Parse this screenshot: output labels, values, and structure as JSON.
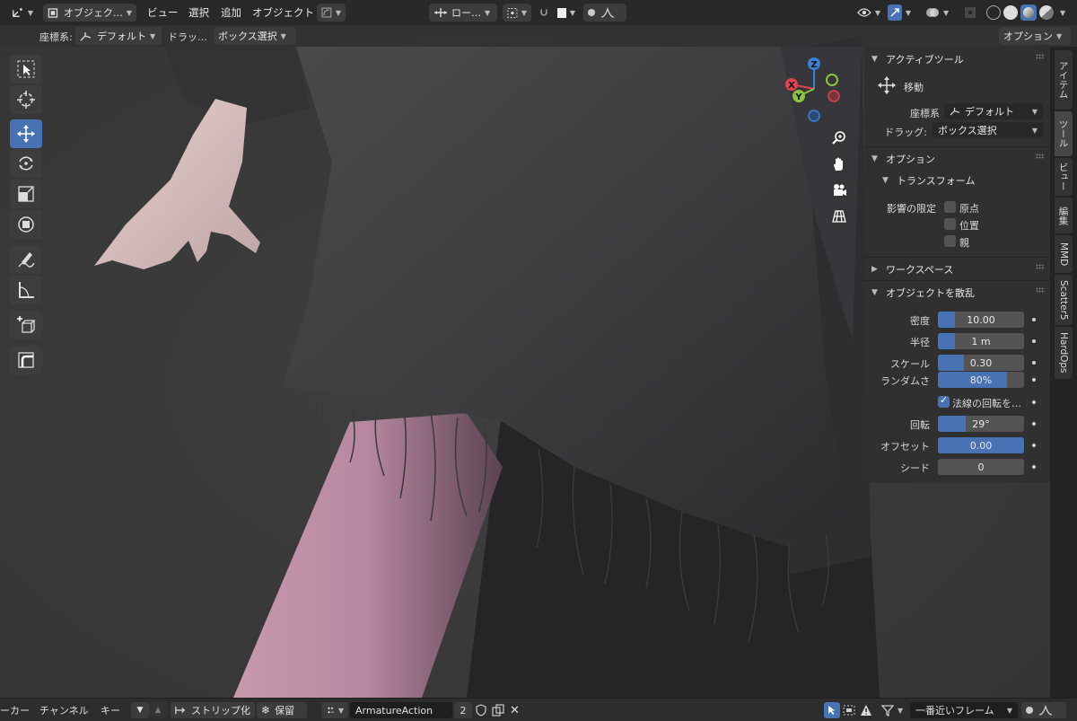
{
  "header": {
    "mode_label": "オブジェク…",
    "menus": [
      "ビュー",
      "選択",
      "追加",
      "オブジェクト"
    ],
    "pivot_label": "ロー…",
    "options_label": "オプション"
  },
  "tool_header": {
    "coord_label": "座標系:",
    "coord_value": "デフォルト",
    "drag_label": "ドラッ…",
    "drag_value": "ボックス選択"
  },
  "left_toolbar": {
    "tools": [
      "select-box",
      "cursor",
      "move",
      "rotate",
      "scale",
      "transform",
      "annotate",
      "measure",
      "add-cube",
      "extrude-shape"
    ],
    "active": "move"
  },
  "gizmo": {
    "x": "X",
    "y": "Y",
    "z": "Z"
  },
  "npanel": {
    "active_tool": {
      "header": "アクティブツール",
      "tool_name": "移動",
      "coord_label": "座標系",
      "coord_value": "デフォルト",
      "drag_label": "ドラッグ:",
      "drag_value": "ボックス選択"
    },
    "options": {
      "header": "オプション",
      "transform_header": "トランスフォーム",
      "affect_label": "影響の限定",
      "checks": [
        {
          "label": "原点",
          "checked": false
        },
        {
          "label": "位置",
          "checked": false
        },
        {
          "label": "親",
          "checked": false
        }
      ]
    },
    "workspace": {
      "header": "ワークスペース"
    },
    "scatter": {
      "header": "オブジェクトを散乱",
      "fields": [
        {
          "label": "密度",
          "value": "10.00",
          "fill": 0.2
        },
        {
          "label": "半径",
          "value": "1 m",
          "fill": 0.2
        },
        {
          "label": "スケール",
          "value": "0.30",
          "fill": 0.3
        },
        {
          "label": "ランダムさ",
          "value": "80%",
          "fill": 0.8
        }
      ],
      "normal_rotation": {
        "label": "法線の回転を…",
        "checked": true
      },
      "fields2": [
        {
          "label": "回転",
          "value": "29°",
          "fill": 0.32
        },
        {
          "label": "オフセット",
          "value": "0.00",
          "fill": 1.0
        },
        {
          "label": "シード",
          "value": "0",
          "fill": 0.0
        }
      ]
    }
  },
  "side_tabs": [
    "アイテム",
    "ツール",
    "ビュー",
    "編集",
    "MMD",
    "Scatter5",
    "HardOps"
  ],
  "side_tabs_active": "ツール",
  "bottom": {
    "marker": "ーカー",
    "channel": "チャンネル",
    "key": "キー",
    "strip_label": "ストリップ化",
    "hold_label": "保留",
    "action_name": "ArmatureAction",
    "users": "2",
    "snap_label": "一番近いフレーム"
  },
  "colors": {
    "accent": "#4772b3",
    "panel": "#303030",
    "axis_x": "#e0424f",
    "axis_y": "#8bc53f",
    "axis_z": "#3a82d8"
  }
}
